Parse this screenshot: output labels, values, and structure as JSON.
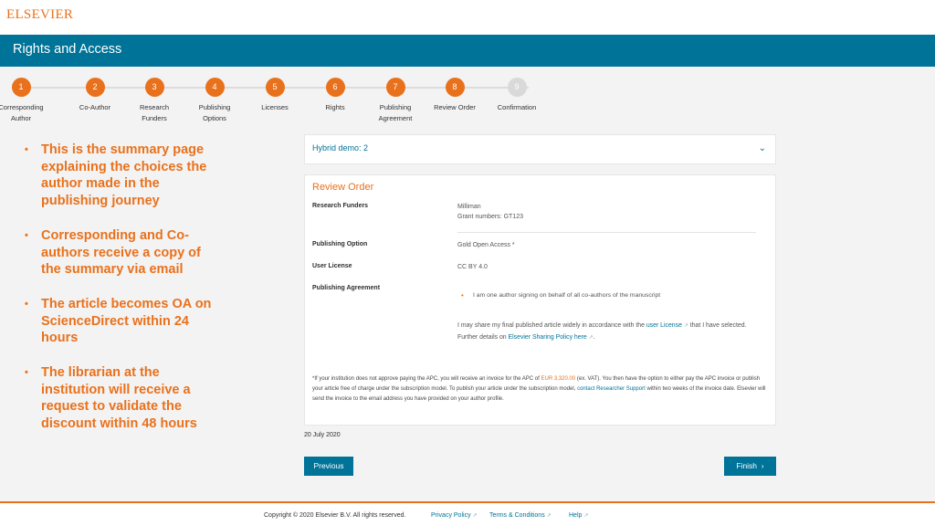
{
  "brand": {
    "logo": "ELSEVIER",
    "accent": "#e9711c",
    "primary": "#007398"
  },
  "header": {
    "title": "Rights and Access"
  },
  "steps": [
    {
      "num": "1",
      "label_line1": "Corresponding",
      "label_line2": "Author",
      "status": "done"
    },
    {
      "num": "2",
      "label_line1": "Co-Author",
      "label_line2": "",
      "status": "done"
    },
    {
      "num": "3",
      "label_line1": "Research",
      "label_line2": "Funders",
      "status": "done"
    },
    {
      "num": "4",
      "label_line1": "Publishing",
      "label_line2": "Options",
      "status": "done"
    },
    {
      "num": "5",
      "label_line1": "Licenses",
      "label_line2": "",
      "status": "done"
    },
    {
      "num": "6",
      "label_line1": "Rights",
      "label_line2": "",
      "status": "done"
    },
    {
      "num": "7",
      "label_line1": "Publishing",
      "label_line2": "Agreement",
      "status": "done"
    },
    {
      "num": "8",
      "label_line1": "Review Order",
      "label_line2": "",
      "status": "current"
    },
    {
      "num": "9",
      "label_line1": "Confirmation",
      "label_line2": "",
      "status": "pending"
    }
  ],
  "bullets": [
    "This is the summary page explaining the choices the author made in the publishing journey",
    "Corresponding and Co-authors receive a copy of the summary via email",
    "The article becomes OA on ScienceDirect within 24 hours",
    "The librarian at the institution will receive a request to validate the discount within 48 hours"
  ],
  "hybrid": {
    "label": "Hybrid demo: 2",
    "chevron": "chevron-down-icon"
  },
  "review": {
    "title": "Review Order",
    "funders_label": "Research Funders",
    "funders_value": "Milliman",
    "grant_numbers": "Grant numbers: GT123",
    "option_label": "Publishing Option",
    "option_value": "Gold Open Access *",
    "license_label": "User License",
    "license_value": "CC BY 4.0",
    "agreement_label": "Publishing Agreement",
    "agreement_value": "I am one author signing on behalf of all co-authors of the manuscript",
    "share_text_1": "I may share my final published article widely in accordance with the",
    "share_link": "user License",
    "share_text_2": "that I have selected.",
    "further_text": "Further details on",
    "policy_link": "Elsevier Sharing Policy here",
    "note_1": "*If your institution does not approve paying the APC, you will receive an invoice for the APC of",
    "note_amount": "EUR 3,320.00",
    "note_2": "(ex. VAT). You then have the option to either pay the APC invoice or publish your article free of charge under the subscription model. To publish your article under the subscription model,",
    "note_link": "contact Researcher Support",
    "note_3": "within two weeks of the invoice date. Elsevier will send the invoice to the email address you have provided on your author profile."
  },
  "date": "20 July 2020",
  "buttons": {
    "previous": "Previous",
    "finish": "Finish",
    "finish_icon": "chevron-right-icon"
  },
  "footer": {
    "copyright": "Copyright © 2020 Elsevier B.V. All rights reserved.",
    "privacy": "Privacy Policy",
    "terms": "Terms & Conditions",
    "help": "Help"
  }
}
